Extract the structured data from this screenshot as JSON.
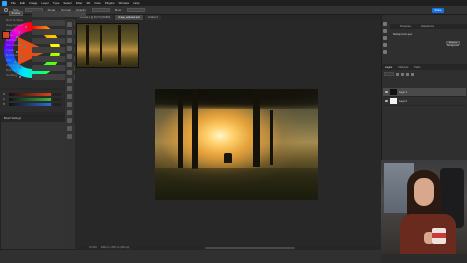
{
  "menubar": {
    "items": [
      "File",
      "Edit",
      "Image",
      "Layer",
      "Type",
      "Select",
      "Filter",
      "3D",
      "View",
      "Plugins",
      "Window",
      "Help"
    ]
  },
  "options": {
    "size_label": "Size:",
    "mode_label": "Mode:",
    "mode_value": "Normal",
    "opacity_label": "Opacity:",
    "flow_label": "Flow:",
    "share_label": "Share"
  },
  "tabs": [
    {
      "label": "Untitled-1 @ 66.7% (RGB/8)",
      "active": false
    },
    {
      "label": "Image_adjusted.psd",
      "active": true
    },
    {
      "label": "Untitled-2",
      "active": false
    }
  ],
  "brush_panel": {
    "title": "Brush Settings",
    "brushes_button": "Brushes",
    "options": [
      "Brush Tip Shape",
      "Shape Dynamics",
      "Scattering",
      "Texture",
      "Dual Brush",
      "Color Dynamics",
      "Transfer",
      "Brush Pose",
      "Noise",
      "Wet Edges",
      "Build-up",
      "Smoothing"
    ]
  },
  "sliders": {
    "labels": [
      "R",
      "G",
      "B"
    ],
    "colors": [
      "#d9441b",
      "#3cbd3c",
      "#2d6bd9"
    ]
  },
  "status": {
    "zoom": "33.33%",
    "doc": "4000 px x 2667 px (300 ppi)"
  },
  "properties": {
    "tabs": [
      "Properties",
      "Adjustments"
    ],
    "title": "Background Layer",
    "button": "Remove Background"
  },
  "layers": {
    "tabs": [
      "Layers",
      "Channels",
      "Paths"
    ],
    "kind_label": "Kind",
    "rows": [
      {
        "name": "Layer 1",
        "selected": true,
        "thumb": "#101010"
      },
      {
        "name": "Layer 0",
        "selected": false,
        "thumb": "#f2f2f2"
      }
    ]
  }
}
